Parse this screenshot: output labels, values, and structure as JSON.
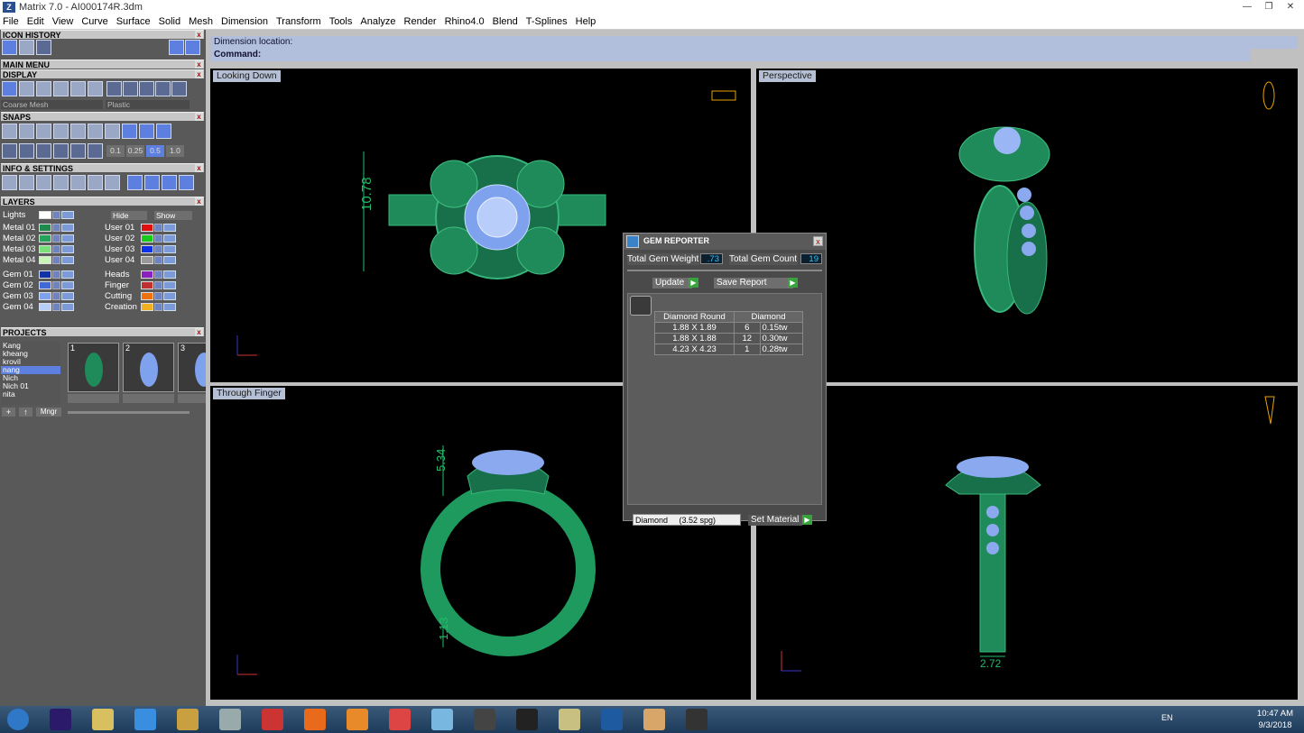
{
  "window": {
    "title": "Matrix 7.0 - AI000174R.3dm",
    "app_icon": "Z"
  },
  "menu": [
    "File",
    "Edit",
    "View",
    "Curve",
    "Surface",
    "Solid",
    "Mesh",
    "Dimension",
    "Transform",
    "Tools",
    "Analyze",
    "Render",
    "Rhino4.0",
    "Blend",
    "T-Splines",
    "Help"
  ],
  "left": {
    "icon_history": "ICON HISTORY",
    "main_menu": "MAIN MENU",
    "display": "DISPLAY",
    "display_mesh": "Coarse Mesh",
    "display_material": "Plastic",
    "snaps": "SNAPS",
    "snap_values": [
      "0.1",
      "0.25",
      "0.5",
      "1.0"
    ],
    "info_settings": "INFO & SETTINGS",
    "layers": "LAYERS",
    "lights": "Lights",
    "hide": "Hide",
    "show": "Show",
    "layer_rows_left": [
      {
        "name": "Metal 01",
        "color": "#1f8a4e"
      },
      {
        "name": "Metal 02",
        "color": "#26a35a"
      },
      {
        "name": "Metal 03",
        "color": "#7ae07a"
      },
      {
        "name": "Metal 04",
        "color": "#c9f5b9"
      },
      {
        "name": "Gem 01",
        "color": "#1233a8"
      },
      {
        "name": "Gem 02",
        "color": "#3f6ad8"
      },
      {
        "name": "Gem 03",
        "color": "#7fa2ef"
      },
      {
        "name": "Gem 04",
        "color": "#b7cdfa"
      }
    ],
    "layer_rows_right": [
      {
        "name": "User 01",
        "color": "#e01010"
      },
      {
        "name": "User 02",
        "color": "#18c81a"
      },
      {
        "name": "User 03",
        "color": "#1030e8"
      },
      {
        "name": "User 04",
        "color": "#9a9a9a"
      },
      {
        "name": "Heads",
        "color": "#8a20c0"
      },
      {
        "name": "Finger",
        "color": "#c03030"
      },
      {
        "name": "Cutting",
        "color": "#f07010"
      },
      {
        "name": "Creation",
        "color": "#f0b020"
      }
    ],
    "projects": "PROJECTS",
    "project_list": [
      "Kang",
      "kheang",
      "krovil",
      "nang",
      "Nich",
      "Nich 01",
      "nita"
    ],
    "project_selected": "nang",
    "thumb_nums": [
      "1",
      "2",
      "3"
    ],
    "mngr": "Mngr"
  },
  "command": {
    "dimension_location": "Dimension location:",
    "command_label": "Command:"
  },
  "viewports": {
    "top_left": "Looking Down",
    "top_right": "Perspective",
    "bottom_left": "Through Finger",
    "bottom_right": ""
  },
  "dimensions": {
    "looking_down_height": "10.78",
    "through_finger_top": "5.34",
    "through_finger_bottom": "1.13",
    "side_width": "2.72"
  },
  "axes": {
    "x": "x",
    "y": "y",
    "z": "z"
  },
  "gem_reporter": {
    "title": "GEM REPORTER",
    "total_weight_label": "Total Gem Weight",
    "total_weight": ".73",
    "total_count_label": "Total Gem Count",
    "total_count": "19",
    "update": "Update",
    "save_report": "Save Report",
    "table_headers": [
      "Diamond Round",
      "Diamond"
    ],
    "rows": [
      {
        "size": "1.88 X 1.89",
        "count": "6",
        "weight": "0.15tw"
      },
      {
        "size": "1.88 X 1.88",
        "count": "12",
        "weight": "0.30tw"
      },
      {
        "size": "4.23 X 4.23",
        "count": "1",
        "weight": "0.28tw"
      }
    ],
    "material": "Diamond     (3.52 spg)",
    "set_material": "Set Material"
  },
  "tray": {
    "lang": "EN",
    "time": "10:47 AM",
    "date": "9/3/2018"
  },
  "taskbar_icons": [
    "start-icon",
    "premiere-icon",
    "folder-icon",
    "ie-icon",
    "explorer-icon",
    "calculator-icon",
    "snipping-icon",
    "firefox-icon",
    "media-icon",
    "chrome-icon",
    "eraser-icon",
    "pen-icon",
    "zbrush-icon",
    "notes-icon",
    "matrix-icon",
    "paint-icon",
    "app-icon"
  ]
}
